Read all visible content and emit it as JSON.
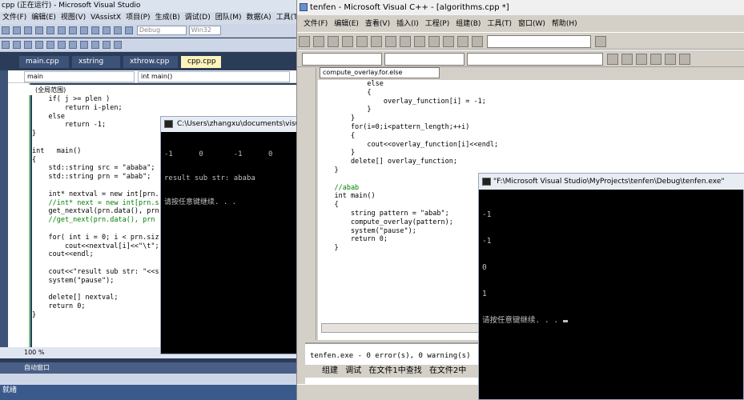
{
  "vs": {
    "title": "cpp (正在运行) - Microsoft Visual Studio",
    "menu": [
      "文件(F)",
      "编辑(E)",
      "视图(V)",
      "VAssistX",
      "项目(P)",
      "生成(B)",
      "调试(D)",
      "团队(M)",
      "数据(A)",
      "工具(T)"
    ],
    "config_combo": "Debug",
    "platform_combo": "Win32",
    "tabs": [
      "main.cpp",
      "xstring",
      "xthrow.cpp",
      "cpp.cpp"
    ],
    "nav_left": "main",
    "nav_right": "int main()",
    "scope": "(全局范围)",
    "code": [
      "    if( j >= plen )",
      "        return i-plen;",
      "    else",
      "        return -1;",
      "}",
      "",
      "int   main()",
      "{",
      "    std::string src = \"ababa\";",
      "    std::string prn = \"abab\";",
      "",
      "    int* nextval = new int[prn.",
      "    //int* next = new int[prn.s",
      "    get_nextval(prn.data(), prn",
      "    //get_next(prn.data(), prn",
      "",
      "    for( int i = 0; i < prn.siz",
      "        cout<<nextval[i]<<\"\\t\";",
      "    cout<<endl;",
      "",
      "    cout<<\"result sub str: \"<<s",
      "    system(\"pause\");",
      "",
      "    delete[] nextval;",
      "    return 0;",
      "}"
    ],
    "zoom": "100 %",
    "auto_window": "自动窗口",
    "status": "就绪"
  },
  "console1": {
    "title": "C:\\Users\\zhangxu\\documents\\visual",
    "lines": [
      "-1      0       -1      0",
      "result sub str: ababa",
      "请按任意键继续. . ."
    ]
  },
  "vc": {
    "title": "tenfen - Microsoft Visual C++ - [algorithms.cpp *]",
    "menu": [
      "文件(F)",
      "编辑(E)",
      "查看(V)",
      "插入(I)",
      "工程(P)",
      "组建(B)",
      "工具(T)",
      "窗口(W)",
      "帮助(H)"
    ],
    "nav_combo": "compute_overlay.for.else",
    "code": [
      "            else",
      "            {",
      "                overlay_function[i] = -1;",
      "            }",
      "        }",
      "        for(i=0;i<pattern_length;++i)",
      "        {",
      "            cout<<overlay_function[i]<<endl;",
      "        }",
      "        delete[] overlay_function;",
      "    }",
      "",
      "    //abab",
      "    int main()",
      "    {",
      "        string pattern = \"abab\";",
      "        compute_overlay(pattern);",
      "        system(\"pause\");",
      "        return 0;",
      "    }"
    ],
    "output_line": "tenfen.exe - 0 error(s), 0 warning(s)",
    "output_tabs": [
      "组建",
      "调试",
      "在文件1中查找",
      "在文件2中"
    ]
  },
  "console2": {
    "title": "\"F:\\Microsoft Visual Studio\\MyProjects\\tenfen\\Debug\\tenfen.exe\"",
    "lines": [
      "-1",
      "-1",
      "0",
      "1",
      "请按任意键继续. . ."
    ]
  }
}
